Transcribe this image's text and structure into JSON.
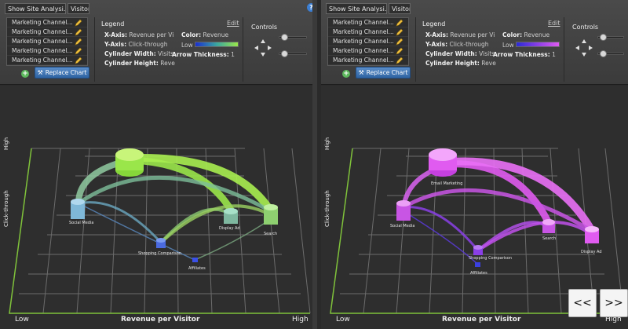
{
  "colors": {
    "panel_bg": "#2e2e2e",
    "toolbar_bg": "#444444",
    "grid": "#6a6a6a",
    "left_series": "#9ae64a",
    "left_low": "#1a30c8",
    "right_series": "#e05bf0",
    "right_low": "#2b2bd8",
    "button_blue": "#3f74b6"
  },
  "panels": [
    {
      "view_select": "Show Site Analysi...",
      "segment_select": "Visitor",
      "channels": [
        "Marketing Channel...",
        "Marketing Channel...",
        "Marketing Channel...",
        "Marketing Channel...",
        "Marketing Channel..."
      ],
      "replace_label": "Replace Chart",
      "add_label": "+",
      "legend": {
        "title": "Legend",
        "edit": "Edit",
        "x_key": "X-Axis:",
        "x_val": "Revenue per Vi",
        "y_key": "Y-Axis:",
        "y_val": "Click-through",
        "w_key": "Cylinder Width:",
        "w_val": "Visits",
        "h_key": "Cylinder Height:",
        "h_val": "Reve",
        "color_key": "Color:",
        "color_val": "Revenue",
        "low": "Low",
        "arrow_key": "Arrow Thickness:",
        "arrow_val": "1"
      },
      "controls_title": "Controls",
      "help": "?",
      "chart": {
        "xlabel": "Revenue per Visitor",
        "ylabel": "Click-through",
        "x_low": "Low",
        "x_high": "High",
        "y_high": "High",
        "nodes": [
          "Social Media",
          "Display Ad",
          "Search",
          "Shopping Comparison",
          "Affiliates"
        ]
      }
    },
    {
      "view_select": "Show Site Analysi...",
      "segment_select": "Visitor",
      "channels": [
        "Marketing Channel...",
        "Marketing Channel...",
        "Marketing Channel...",
        "Marketing Channel...",
        "Marketing Channel..."
      ],
      "replace_label": "Replace Chart",
      "add_label": "+",
      "legend": {
        "title": "Legend",
        "edit": "Edit",
        "x_key": "X-Axis:",
        "x_val": "Revenue per Vi",
        "y_key": "Y-Axis:",
        "y_val": "Click-through",
        "w_key": "Cylinder Width:",
        "w_val": "Visits",
        "h_key": "Cylinder Height:",
        "h_val": "Reve",
        "color_key": "Color:",
        "color_val": "Revenue",
        "low": "Low",
        "arrow_key": "Arrow Thickness:",
        "arrow_val": "1"
      },
      "controls_title": "Controls",
      "chart": {
        "xlabel": "Revenue per Visitor",
        "ylabel": "Click-through",
        "x_low": "Low",
        "x_high": "High",
        "y_high": "High",
        "nodes": [
          "Social Media",
          "Email Marketing",
          "Search",
          "Display Ad",
          "Shopping Comparison",
          "Affiliates"
        ]
      }
    }
  ],
  "nav": {
    "prev": "<<",
    "next": ">>"
  }
}
